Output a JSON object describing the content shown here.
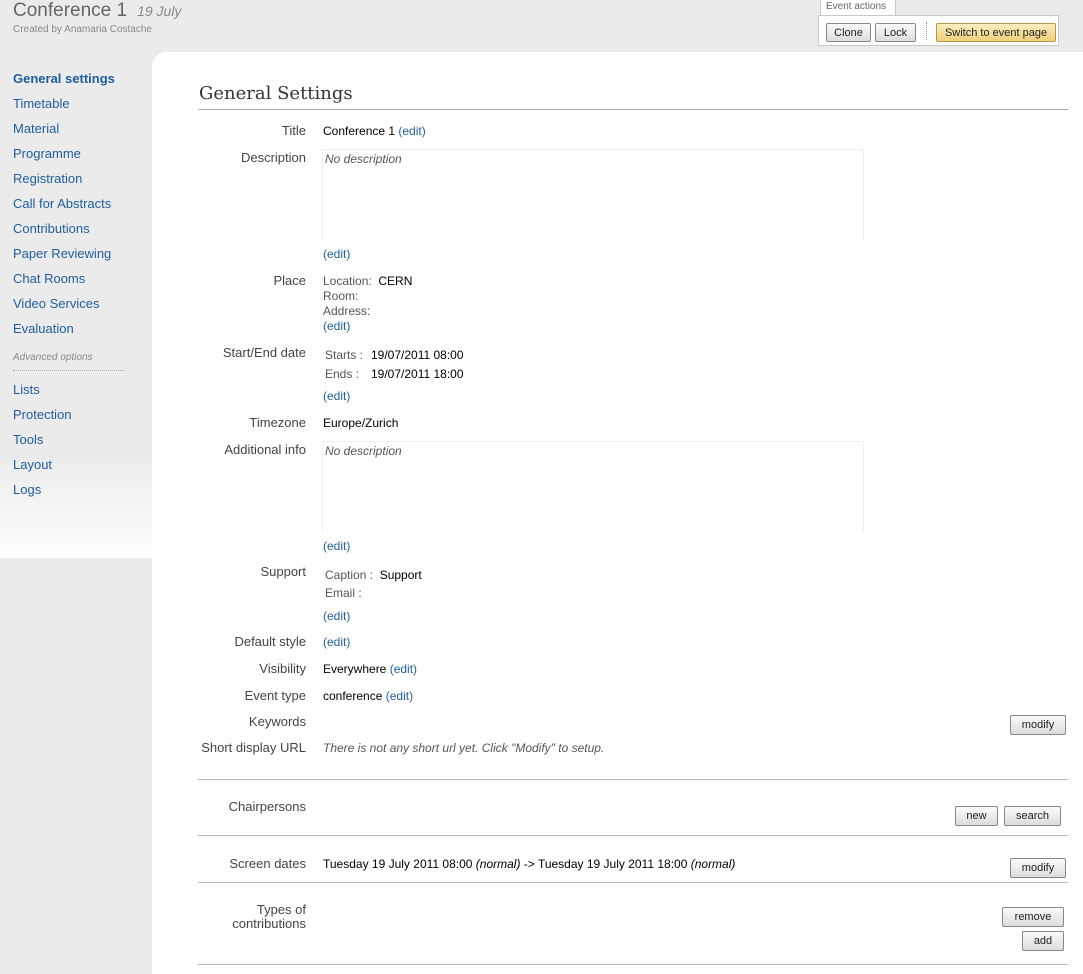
{
  "header": {
    "title": "Conference 1",
    "date": "19 July",
    "created_by": "Created by Anamaria Costache"
  },
  "event_actions": {
    "tab_label": "Event actions",
    "clone": "Clone",
    "lock": "Lock",
    "switch": "Switch to event page"
  },
  "sidebar": {
    "items": [
      "General settings",
      "Timetable",
      "Material",
      "Programme",
      "Registration",
      "Call for Abstracts",
      "Contributions",
      "Paper Reviewing",
      "Chat Rooms",
      "Video Services",
      "Evaluation"
    ],
    "advanced_label": "Advanced options",
    "advanced_items": [
      "Lists",
      "Protection",
      "Tools",
      "Layout",
      "Logs"
    ]
  },
  "main": {
    "title": "General Settings",
    "edit_label": "(edit)",
    "title_row": {
      "label": "Title",
      "value": "Conference 1"
    },
    "description": {
      "label": "Description",
      "value": "No description"
    },
    "place": {
      "label": "Place",
      "location_label": "Location:",
      "location": "CERN",
      "room_label": "Room:",
      "address_label": "Address:"
    },
    "dates": {
      "label": "Start/End date",
      "starts_label": "Starts :",
      "starts": "19/07/2011 08:00",
      "ends_label": "Ends :",
      "ends": "19/07/2011 18:00"
    },
    "timezone": {
      "label": "Timezone",
      "value": "Europe/Zurich"
    },
    "additional": {
      "label": "Additional info",
      "value": "No description"
    },
    "support": {
      "label": "Support",
      "caption_label": "Caption :",
      "caption": "Support",
      "email_label": "Email :"
    },
    "default_style": {
      "label": "Default style"
    },
    "visibility": {
      "label": "Visibility",
      "value": "Everywhere"
    },
    "event_type": {
      "label": "Event type",
      "value": "conference"
    },
    "keywords": {
      "label": "Keywords",
      "modify": "modify"
    },
    "short_url": {
      "label": "Short display URL",
      "value": "There is not any short url yet. Click \"Modify\" to setup."
    },
    "chairpersons": {
      "label": "Chairpersons",
      "new": "new",
      "search": "search"
    },
    "screen_dates": {
      "label": "Screen dates",
      "start": "Tuesday 19 July 2011 08:00",
      "start_mode": "(normal)",
      "arrow": "->",
      "end": "Tuesday 19 July 2011 18:00",
      "end_mode": "(normal)",
      "modify": "modify"
    },
    "types": {
      "label": "Types of contributions",
      "remove": "remove",
      "add": "add"
    }
  }
}
